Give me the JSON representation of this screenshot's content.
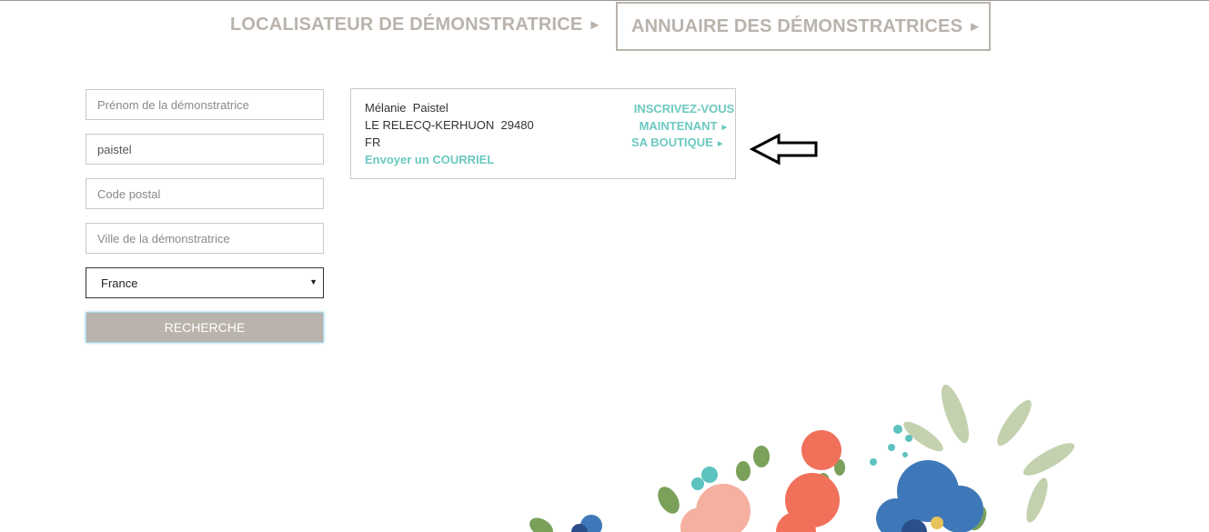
{
  "nav": {
    "locator_label": "LOCALISATEUR DE DÉMONSTRATRICE",
    "directory_label": "ANNUAIRE DES DÉMONSTRATRICES",
    "arrow": "►"
  },
  "form": {
    "first_name_placeholder": "Prénom de la démonstratrice",
    "last_name_value": "paistel",
    "postal_code_placeholder": "Code postal",
    "city_placeholder": "Ville de la démonstratrice",
    "country_selected": "France",
    "caret": "▼",
    "search_label": "RECHERCHE"
  },
  "result": {
    "name": "Mélanie  Paistel",
    "city_line": "LE RELECQ-KERHUON  29480",
    "country": "FR",
    "email_link": "Envoyer un COURRIEL",
    "join_line1": "INSCRIVEZ-VOUS",
    "join_line2": "MAINTENANT",
    "shop_label": "SA BOUTIQUE",
    "arrow": "►"
  },
  "colors": {
    "accent_teal": "#6cc9c0",
    "tab_grey": "#b9b3ac",
    "button_grey": "#b9b3ac"
  },
  "icons": {
    "annotation": "left-arrow-outline-icon",
    "decoration": "watercolor-flowers-illustration"
  }
}
